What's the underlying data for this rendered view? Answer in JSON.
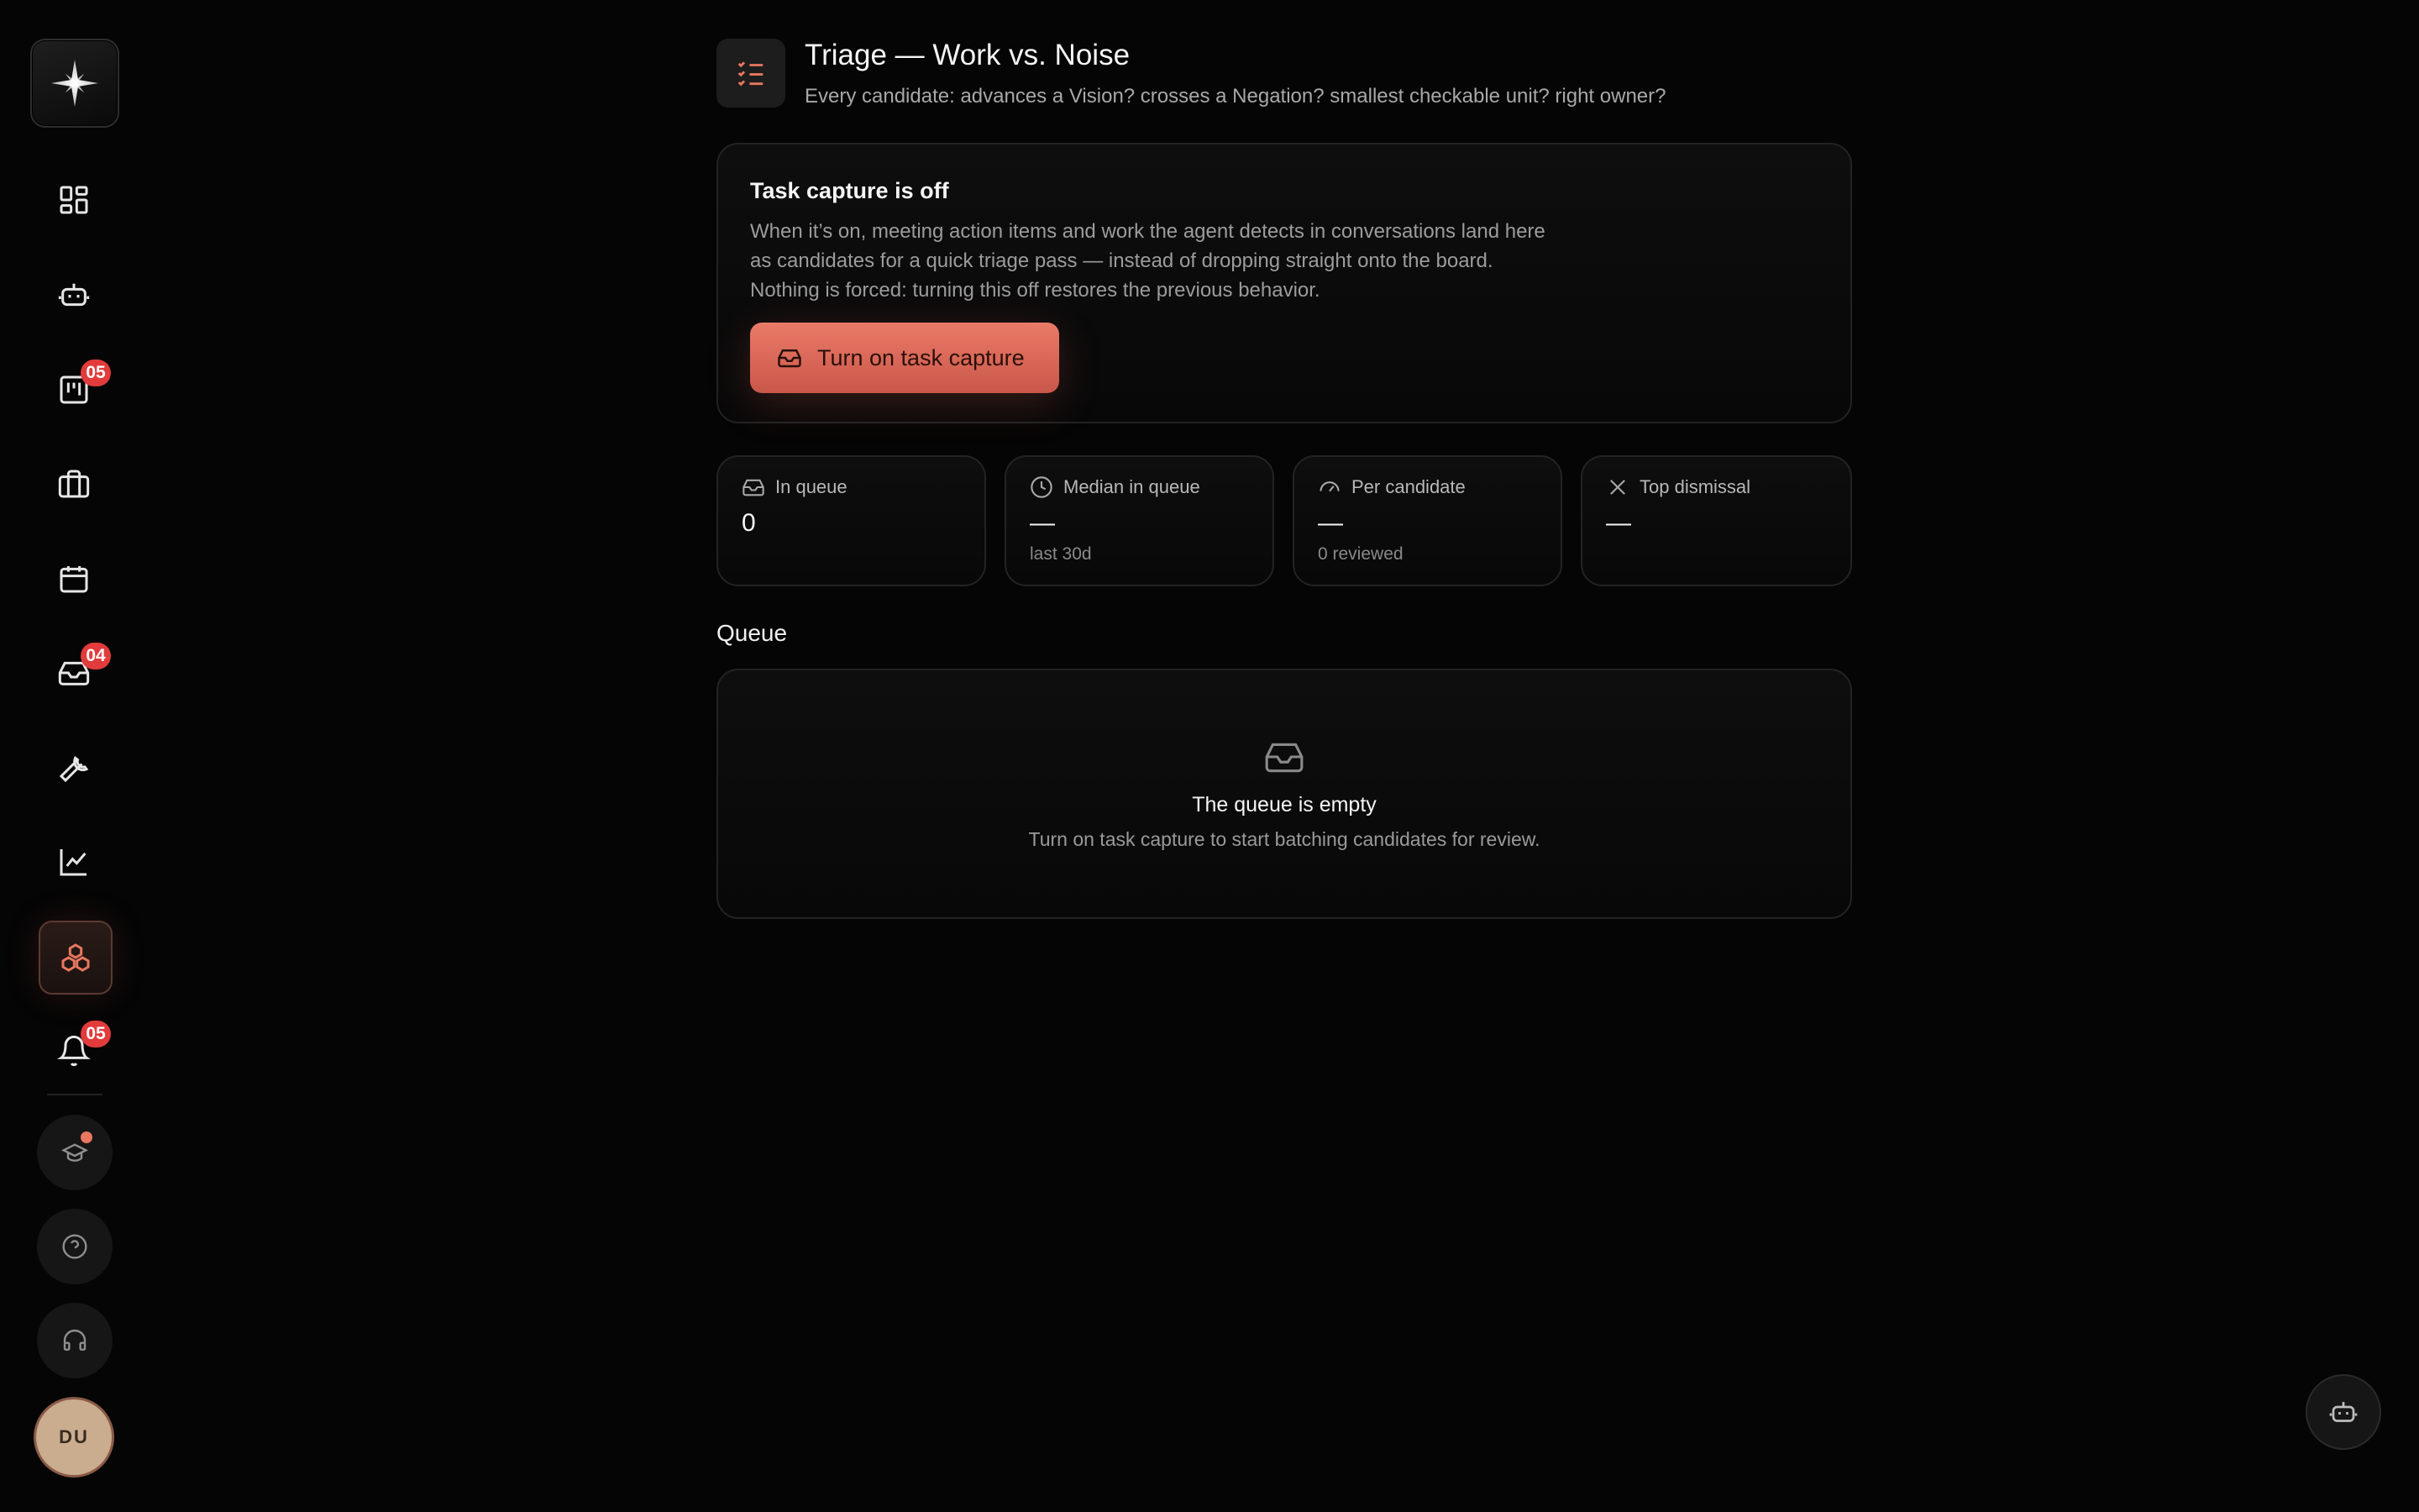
{
  "sidebar": {
    "items": [
      {
        "name": "dashboard-icon"
      },
      {
        "name": "agent-icon"
      },
      {
        "name": "board-icon",
        "badge": "05"
      },
      {
        "name": "briefcase-icon"
      },
      {
        "name": "calendar-icon"
      },
      {
        "name": "inbox-icon",
        "badge": "04"
      },
      {
        "name": "wrench-icon"
      },
      {
        "name": "analytics-icon"
      },
      {
        "name": "cubes-icon",
        "active": true
      },
      {
        "name": "bell-icon",
        "badge": "05"
      }
    ],
    "bottom": [
      {
        "name": "graduation-cap-icon"
      },
      {
        "name": "help-icon"
      },
      {
        "name": "headset-icon"
      }
    ],
    "avatar_initials": "DU"
  },
  "header": {
    "title": "Triage — Work vs. Noise",
    "subtitle": "Every candidate: advances a Vision? crosses a Negation? smallest checkable unit? right owner?"
  },
  "capture": {
    "title": "Task capture is off",
    "body": "When it’s on, meeting action items and work the agent detects in conversations land here as candidates for a quick triage pass — instead of dropping straight onto the board. Nothing is forced: turning this off restores the previous behavior.",
    "button_label": "Turn on task capture"
  },
  "stats": [
    {
      "label": "In queue",
      "icon": "inbox-icon",
      "value": "0",
      "sub": ""
    },
    {
      "label": "Median in queue",
      "icon": "clock-icon",
      "value": "—",
      "sub": "last 30d"
    },
    {
      "label": "Per candidate",
      "icon": "gauge-icon",
      "value": "—",
      "sub": "0 reviewed"
    },
    {
      "label": "Top dismissal",
      "icon": "close-icon",
      "value": "—",
      "sub": ""
    }
  ],
  "queue": {
    "heading": "Queue",
    "empty_title": "The queue is empty",
    "empty_subtitle": "Turn on task capture to start batching candidates for review."
  },
  "colors": {
    "background": "#050505",
    "accent": "#e8775f",
    "badge": "#e23b3b"
  }
}
